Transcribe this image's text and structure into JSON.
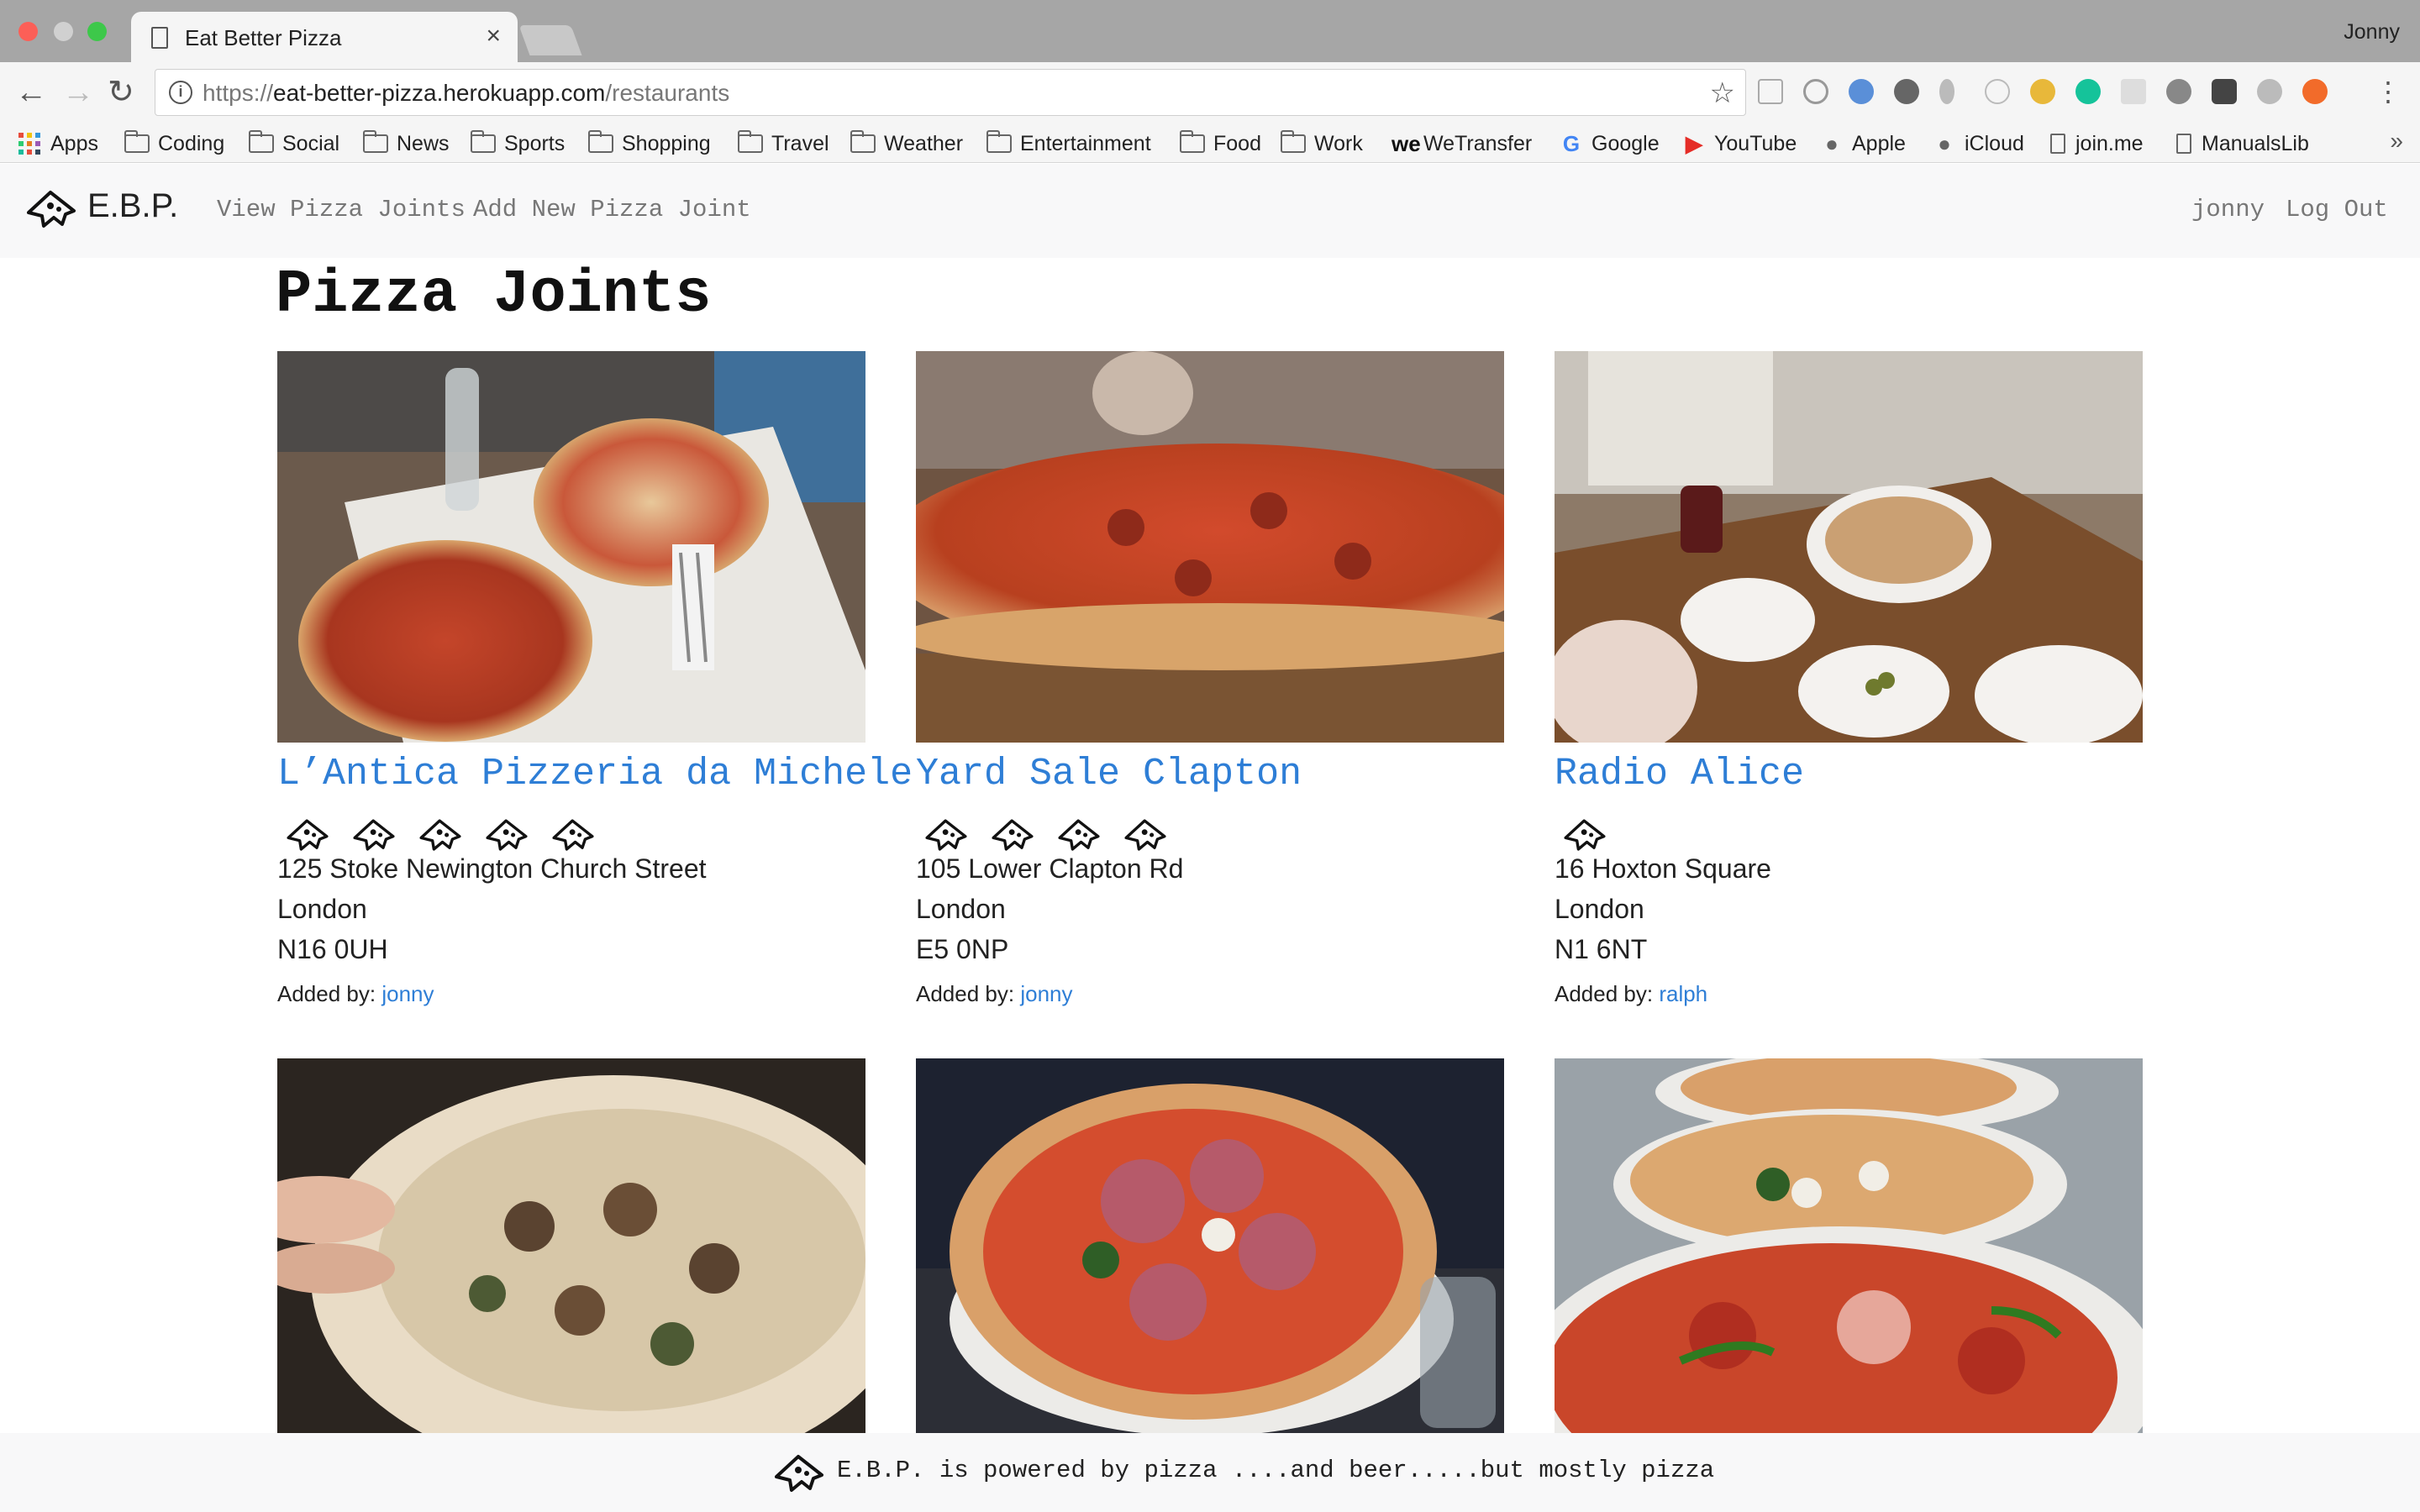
{
  "browser": {
    "tab_title": "Eat Better Pizza",
    "tab_close": "×",
    "profile": "Jonny",
    "url": {
      "proto": "https://",
      "host": "eat-better-pizza.herokuapp.com",
      "path": "/restaurants"
    },
    "bookmarks": [
      {
        "label": "Apps",
        "icon": "apps-grid-icon"
      },
      {
        "label": "Coding",
        "icon": "folder-icon"
      },
      {
        "label": "Social",
        "icon": "folder-icon"
      },
      {
        "label": "News",
        "icon": "folder-icon"
      },
      {
        "label": "Sports",
        "icon": "folder-icon"
      },
      {
        "label": "Shopping",
        "icon": "folder-icon"
      },
      {
        "label": "Travel",
        "icon": "folder-icon"
      },
      {
        "label": "Weather",
        "icon": "folder-icon"
      },
      {
        "label": "Entertainment",
        "icon": "folder-icon"
      },
      {
        "label": "Food",
        "icon": "folder-icon"
      },
      {
        "label": "Work",
        "icon": "folder-icon"
      },
      {
        "label": "WeTransfer",
        "icon": "wetransfer-icon"
      },
      {
        "label": "Google",
        "icon": "google-icon"
      },
      {
        "label": "YouTube",
        "icon": "youtube-icon"
      },
      {
        "label": "Apple",
        "icon": "apple-icon"
      },
      {
        "label": "iCloud",
        "icon": "apple-icon"
      },
      {
        "label": "join.me",
        "icon": "page-icon"
      },
      {
        "label": "ManualsLib",
        "icon": "page-icon"
      }
    ],
    "bookmarks_more": "»"
  },
  "app": {
    "brand": "E.B.P.",
    "nav": {
      "view": "View Pizza Joints",
      "add": "Add New Pizza Joint",
      "user": "jonny",
      "logout": "Log Out"
    },
    "page_title": "Pizza Joints",
    "added_by_label": "Added by:",
    "restaurants": [
      {
        "name": "L’Antica Pizzeria da Michele",
        "rating": 5,
        "street": "125 Stoke Newington Church Street",
        "city": "London",
        "postcode": "N16 0UH",
        "added_by": "jonny"
      },
      {
        "name": "Yard Sale Clapton",
        "rating": 4,
        "street": "105 Lower Clapton Rd",
        "city": "London",
        "postcode": "E5 0NP",
        "added_by": "jonny"
      },
      {
        "name": "Radio Alice",
        "rating": 1,
        "street": "16 Hoxton Square",
        "city": "London",
        "postcode": "N1 6NT",
        "added_by": "ralph"
      }
    ],
    "footer": "E.B.P. is powered by pizza ....and beer.....but mostly pizza"
  },
  "colors": {
    "link": "#2e7ed6",
    "nav_bg": "#f8f8f9"
  }
}
